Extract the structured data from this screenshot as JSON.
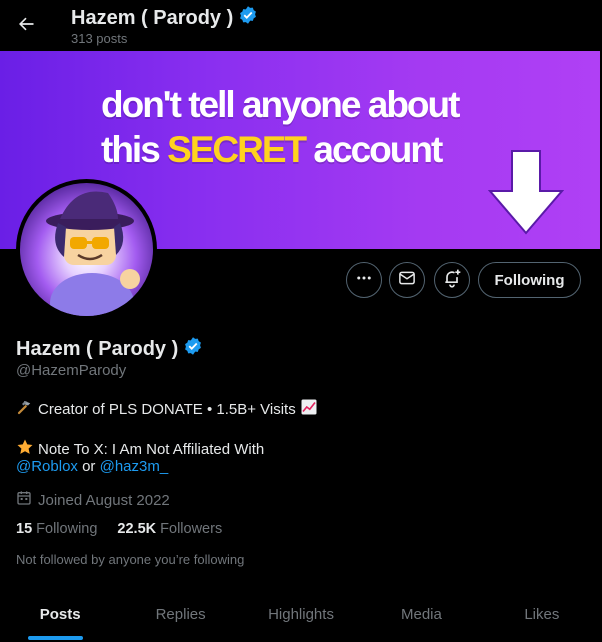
{
  "header": {
    "title": "Hazem ( Parody )",
    "posts_count": "313 posts"
  },
  "banner": {
    "line1": "don't tell anyone about",
    "line2_start": "this ",
    "line2_highlight": "SECRET",
    "line2_end": " account",
    "highlight_color": "#ffd21f"
  },
  "profile": {
    "name": "Hazem ( Parody )",
    "handle": "@HazemParody",
    "bio_line1": "Creator of PLS DONATE • 1.5B+ Visits",
    "bio_line2": "Note To X: I Am Not Affiliated With",
    "bio_link1": "@Roblox",
    "bio_or": " or ",
    "bio_link2": "@haz3m_",
    "joined": "Joined August 2022",
    "following_count": "15",
    "following_label": " Following",
    "followers_count": "22.5K",
    "followers_label": " Followers",
    "not_followed": "Not followed by anyone you’re following"
  },
  "actions": {
    "follow_label": "Following"
  },
  "tabs": [
    {
      "label": "Posts",
      "active": true
    },
    {
      "label": "Replies",
      "active": false
    },
    {
      "label": "Highlights",
      "active": false
    },
    {
      "label": "Media",
      "active": false
    },
    {
      "label": "Likes",
      "active": false
    }
  ],
  "icons": {
    "back": "arrow-left-icon",
    "verified": "verified-badge-icon",
    "more": "more-icon",
    "message": "envelope-icon",
    "notify": "bell-plus-icon",
    "calendar": "calendar-icon"
  },
  "colors": {
    "accent": "#1d9bf0",
    "muted": "#71767b"
  }
}
